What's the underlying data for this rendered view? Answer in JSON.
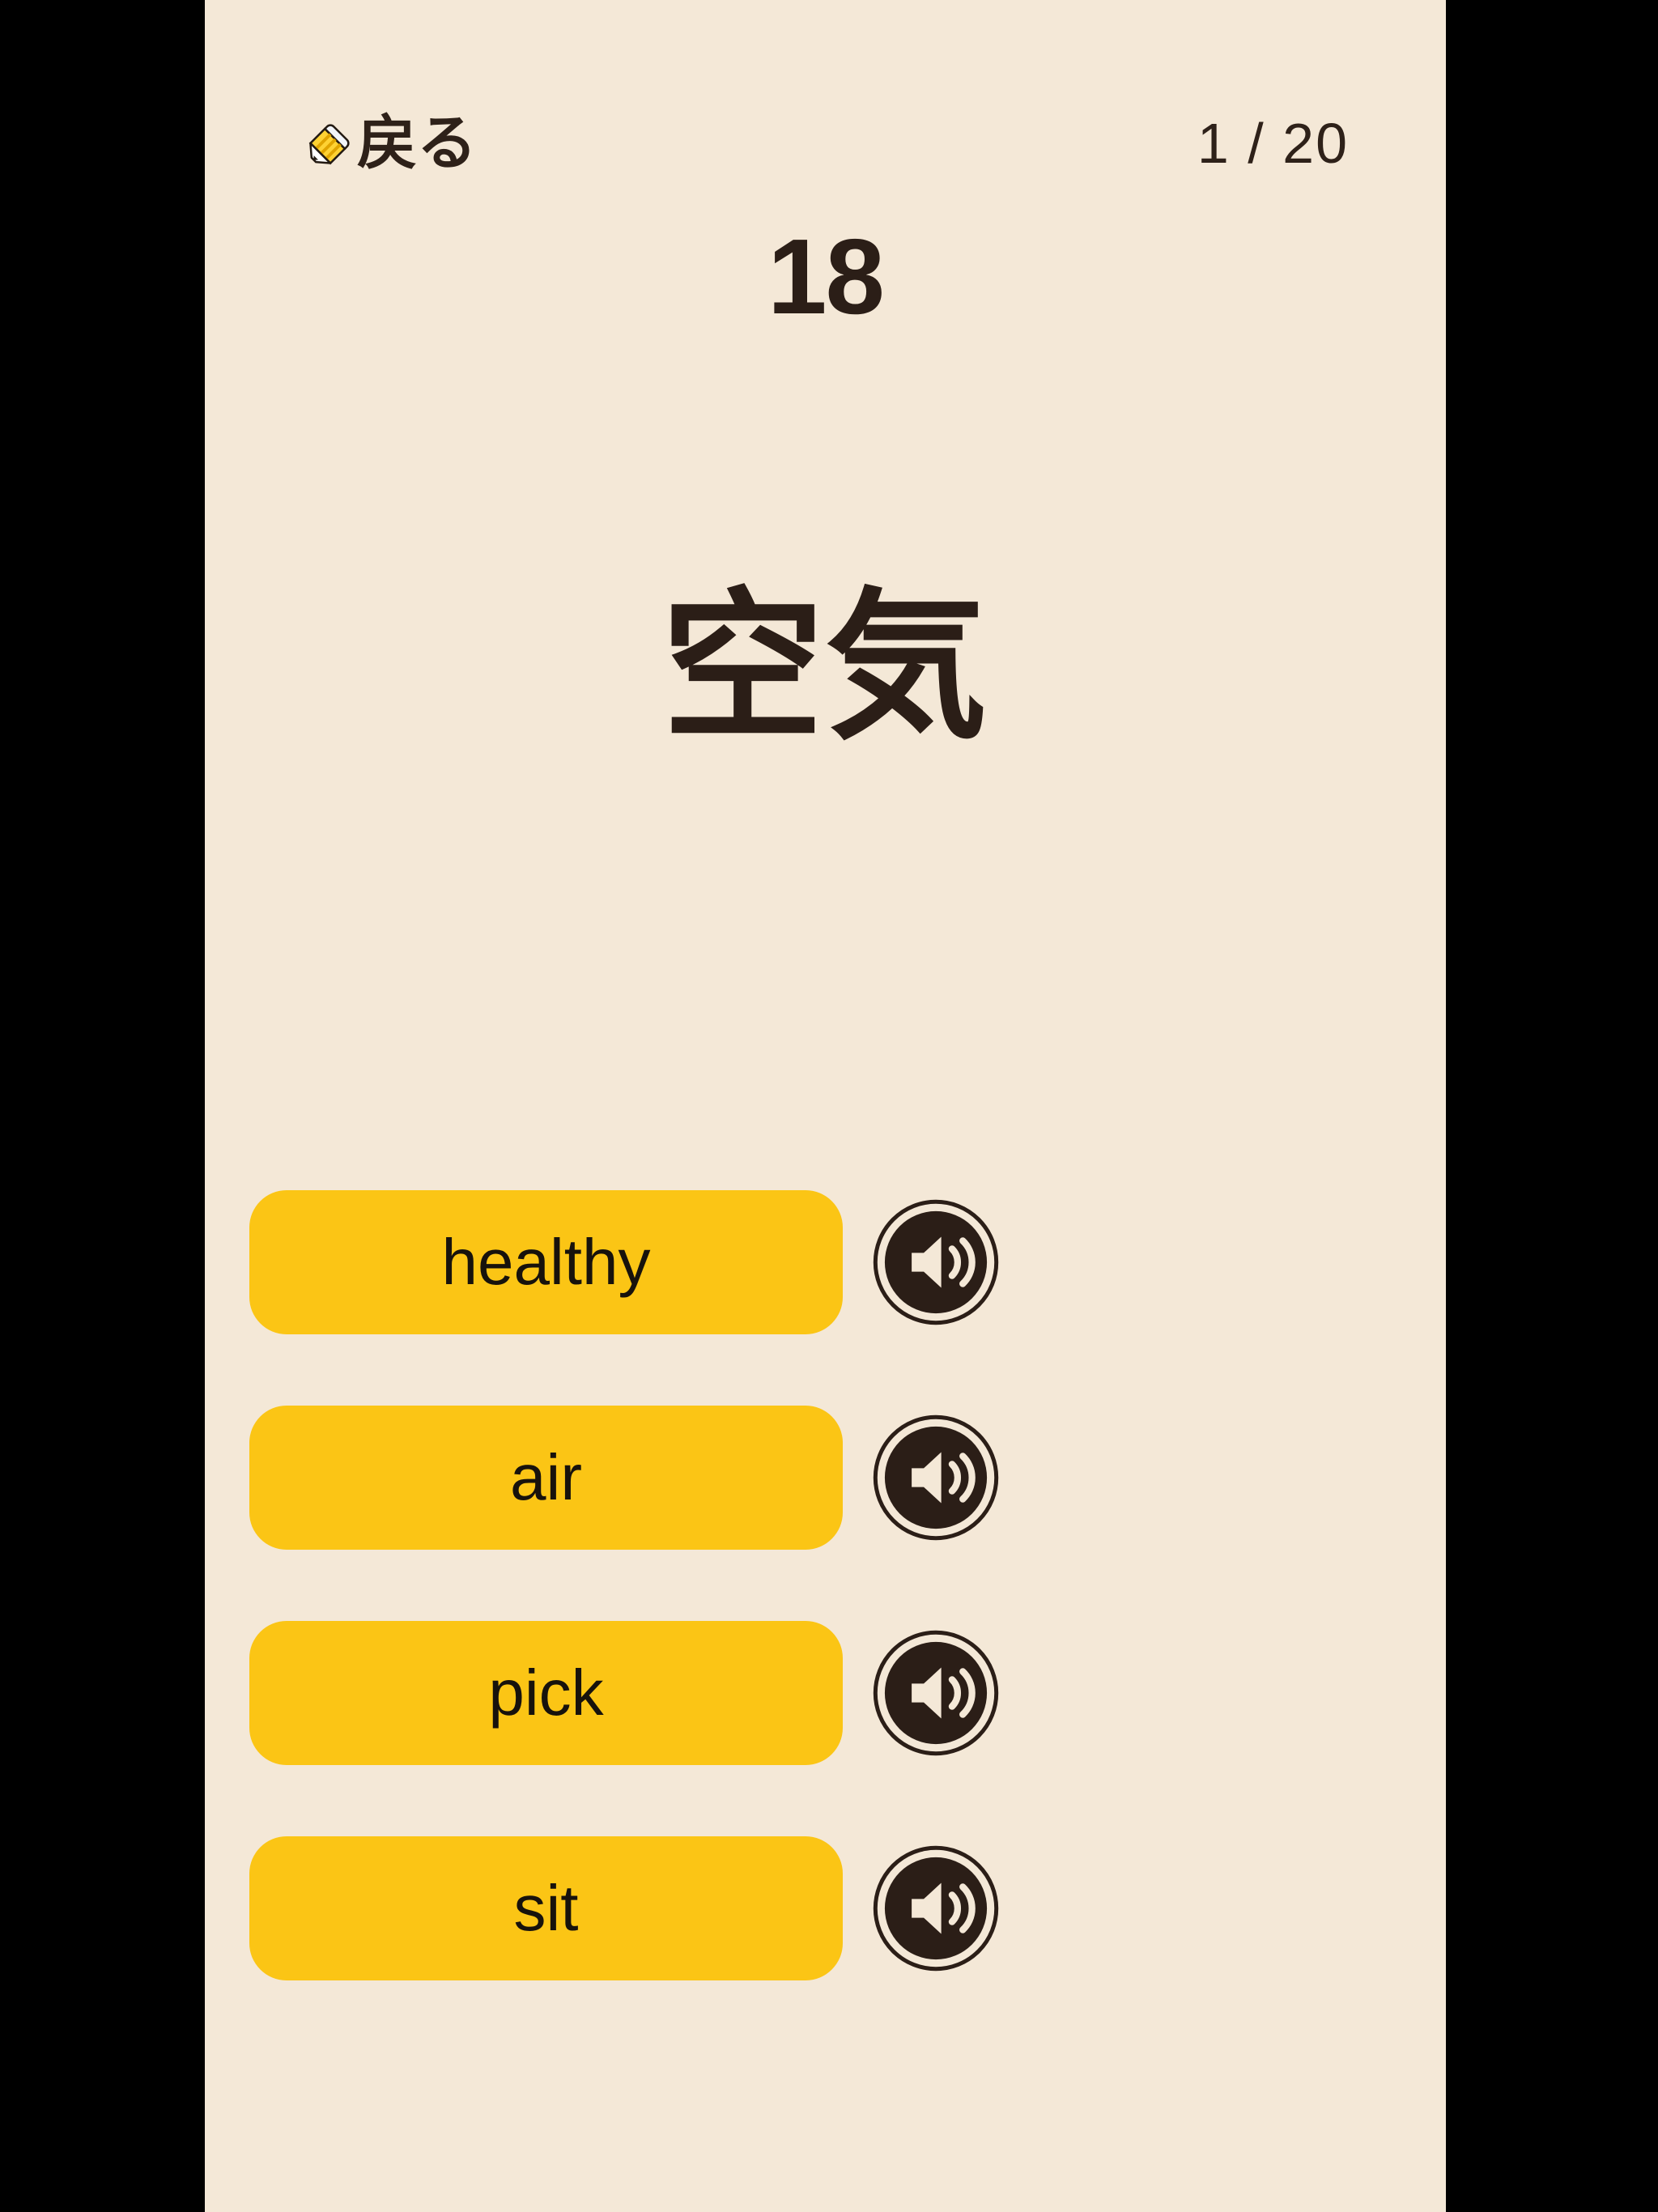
{
  "theme": {
    "page_background": "#000000",
    "app_background": "#F4E8D7",
    "text_color": "#2B1E17",
    "button_color": "#FBC515",
    "button_text_color": "#17120C",
    "icon_color": "#2E2119"
  },
  "header": {
    "back_icon": "pencil-icon",
    "back_label": "戻る",
    "counter": "1 / 20"
  },
  "card": {
    "number": "18",
    "prompt_word": "空気"
  },
  "answers": [
    {
      "label": "healthy",
      "speaker_icon": "speaker-icon"
    },
    {
      "label": "air",
      "speaker_icon": "speaker-icon"
    },
    {
      "label": "pick",
      "speaker_icon": "speaker-icon"
    },
    {
      "label": "sit",
      "speaker_icon": "speaker-icon"
    }
  ]
}
